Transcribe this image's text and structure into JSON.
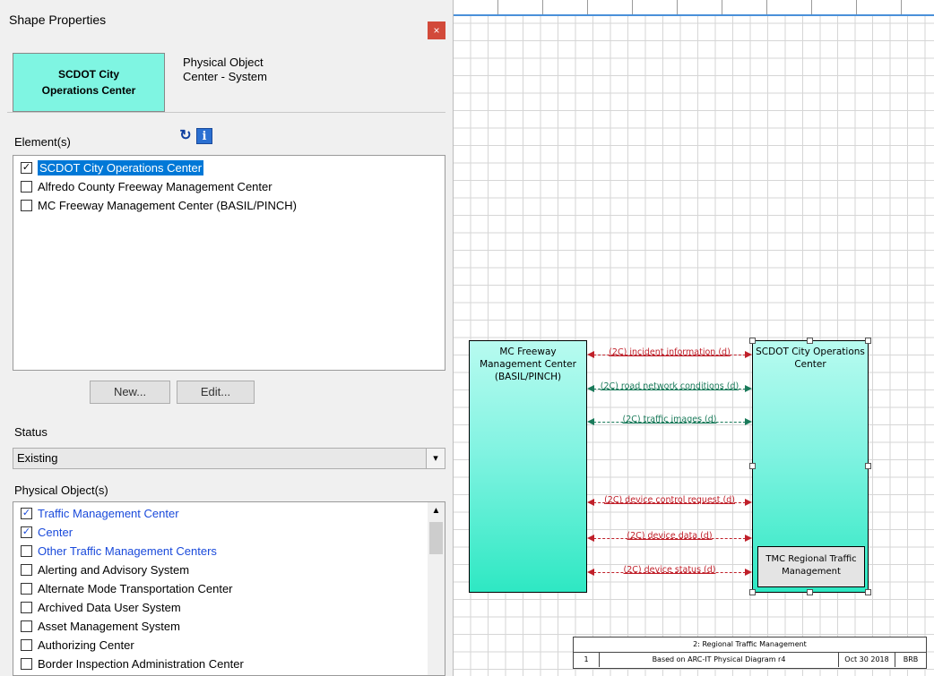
{
  "panel": {
    "title": "Shape Properties",
    "close_label": "×",
    "object_name": "SCDOT City Operations Center",
    "object_type": "Physical Object Center - System",
    "elements_label": "Element(s)",
    "elements": [
      {
        "label": "SCDOT City Operations Center",
        "checked": true,
        "selected": true
      },
      {
        "label": "Alfredo County Freeway Management Center",
        "checked": false
      },
      {
        "label": "MC Freeway Management Center (BASIL/PINCH)",
        "checked": false
      }
    ],
    "new_button": "New...",
    "edit_button": "Edit...",
    "status_label": "Status",
    "status_value": "Existing",
    "physical_objects_label": "Physical Object(s)",
    "physical_objects": [
      {
        "label": "Traffic Management Center",
        "checked": true,
        "blue": true
      },
      {
        "label": "Center",
        "checked": true,
        "blue": true
      },
      {
        "label": "Other Traffic Management Centers",
        "checked": false,
        "blue": true
      },
      {
        "label": "Alerting and Advisory System",
        "checked": false
      },
      {
        "label": "Alternate Mode Transportation Center",
        "checked": false
      },
      {
        "label": "Archived Data User System",
        "checked": false
      },
      {
        "label": "Asset Management System",
        "checked": false
      },
      {
        "label": "Authorizing Center",
        "checked": false
      },
      {
        "label": "Border Inspection Administration Center",
        "checked": false
      }
    ],
    "icons": {
      "refresh": "refresh-icon",
      "info": "info-icon"
    }
  },
  "diagram": {
    "left_block": "MC Freeway Management Center (BASIL/PINCH)",
    "right_block": "SCDOT City Operations Center",
    "sub_block": "TMC Regional Traffic Management",
    "flows": [
      {
        "label": "(2C) incident information (d)",
        "color": "red"
      },
      {
        "label": "(2C) road network conditions (d)",
        "color": "green"
      },
      {
        "label": "(2C) traffic images (d)",
        "color": "green"
      },
      {
        "label": "(2C) device control request (d)",
        "color": "red"
      },
      {
        "label": "(2C) device data (d)",
        "color": "red"
      },
      {
        "label": "(2C) device status (d)",
        "color": "red"
      }
    ],
    "title_block": {
      "title": "2: Regional Traffic Management",
      "number": "1",
      "description": "Based on ARC-IT Physical Diagram r4",
      "date": "Oct 30 2018",
      "author": "BRB"
    }
  }
}
